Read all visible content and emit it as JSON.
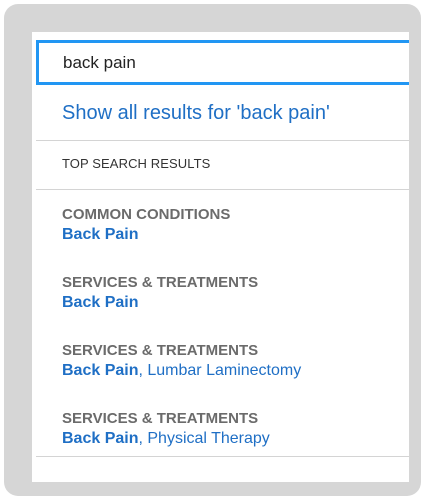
{
  "search": {
    "value": "back pain",
    "show_all_label": "Show all results for 'back pain'"
  },
  "top_results_heading": "TOP SEARCH RESULTS",
  "results": [
    {
      "category": "COMMON CONDITIONS",
      "title": "Back Pain",
      "rest": ""
    },
    {
      "category": "SERVICES & TREATMENTS",
      "title": "Back Pain",
      "rest": ""
    },
    {
      "category": "SERVICES & TREATMENTS",
      "title": "Back Pain",
      "rest": ", Lumbar Laminectomy"
    },
    {
      "category": "SERVICES & TREATMENTS",
      "title": "Back Pain",
      "rest": ", Physical Therapy"
    }
  ],
  "colors": {
    "focus_border": "#2196f3",
    "link": "#1f6fc5",
    "category": "#6b6b6b",
    "frame": "#d6d6d6"
  }
}
